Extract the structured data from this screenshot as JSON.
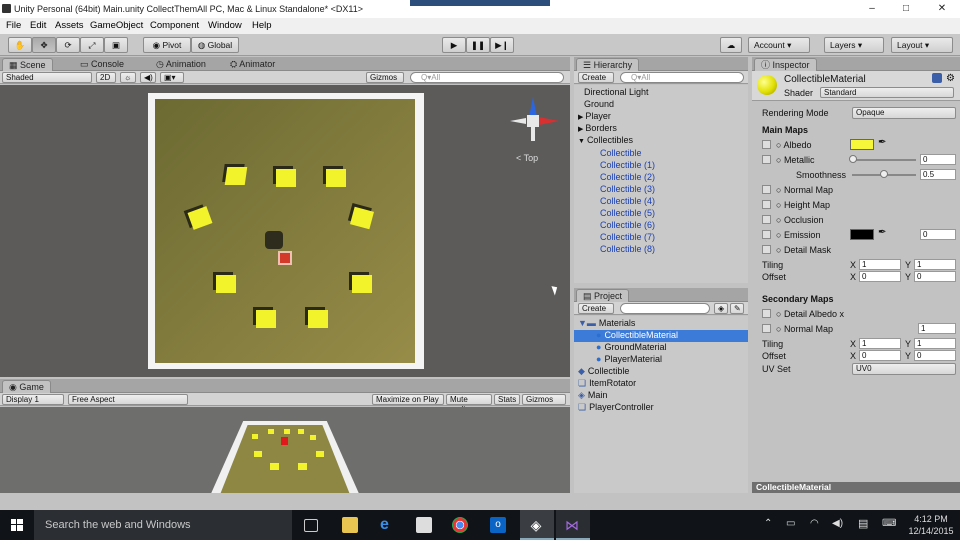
{
  "window": {
    "title": "Unity Personal (64bit)   Main.unity   CollectThemAll   PC, Mac & Linux Standalone* <DX11>",
    "minimize": "–",
    "maximize": "□",
    "close": "✕"
  },
  "menu": [
    "File",
    "Edit",
    "Assets",
    "GameObject",
    "Component",
    "Window",
    "Help"
  ],
  "toolbar": {
    "pivot": "Pivot",
    "global": "Global",
    "account": "Account",
    "layers": "Layers",
    "layout": "Layout"
  },
  "scene": {
    "tabs": {
      "scene": "Scene",
      "console": "Console",
      "animation": "Animation",
      "animator": "Animator"
    },
    "shading": "Shaded",
    "mode2d": "2D",
    "gizmos": "Gizmos",
    "search_placeholder": "Q▾All",
    "view_label": "< Top"
  },
  "game": {
    "tab": "Game",
    "display": "Display 1",
    "aspect": "Free Aspect",
    "maximize": "Maximize on Play",
    "mute": "Mute audio",
    "stats": "Stats",
    "gizmos": "Gizmos"
  },
  "hierarchy": {
    "tab": "Hierarchy",
    "create": "Create",
    "search_placeholder": "Q▾All",
    "items": [
      {
        "label": "Directional Light",
        "indent": 0,
        "arrow": "",
        "blue": false
      },
      {
        "label": "Ground",
        "indent": 0,
        "arrow": "",
        "blue": false
      },
      {
        "label": "Player",
        "indent": 0,
        "arrow": "▶",
        "blue": false
      },
      {
        "label": "Borders",
        "indent": 0,
        "arrow": "▶",
        "blue": false
      },
      {
        "label": "Collectibles",
        "indent": 0,
        "arrow": "▼",
        "blue": false
      },
      {
        "label": "Collectible",
        "indent": 1,
        "arrow": "",
        "blue": true
      },
      {
        "label": "Collectible (1)",
        "indent": 1,
        "arrow": "",
        "blue": true
      },
      {
        "label": "Collectible (2)",
        "indent": 1,
        "arrow": "",
        "blue": true
      },
      {
        "label": "Collectible (3)",
        "indent": 1,
        "arrow": "",
        "blue": true
      },
      {
        "label": "Collectible (4)",
        "indent": 1,
        "arrow": "",
        "blue": true
      },
      {
        "label": "Collectible (5)",
        "indent": 1,
        "arrow": "",
        "blue": true
      },
      {
        "label": "Collectible (6)",
        "indent": 1,
        "arrow": "",
        "blue": true
      },
      {
        "label": "Collectible (7)",
        "indent": 1,
        "arrow": "",
        "blue": true
      },
      {
        "label": "Collectible (8)",
        "indent": 1,
        "arrow": "",
        "blue": true
      }
    ]
  },
  "project": {
    "tab": "Project",
    "create": "Create",
    "items": [
      {
        "label": "Materials",
        "indent": 0,
        "icon": "folder-icon",
        "selected": false
      },
      {
        "label": "CollectibleMaterial",
        "indent": 1,
        "icon": "material-icon",
        "selected": true
      },
      {
        "label": "GroundMaterial",
        "indent": 1,
        "icon": "material-icon",
        "selected": false
      },
      {
        "label": "PlayerMaterial",
        "indent": 1,
        "icon": "material-icon",
        "selected": false
      },
      {
        "label": "Collectible",
        "indent": 0,
        "icon": "prefab-icon",
        "selected": false
      },
      {
        "label": "ItemRotator",
        "indent": 0,
        "icon": "script-icon",
        "selected": false
      },
      {
        "label": "Main",
        "indent": 0,
        "icon": "unity-scene-icon",
        "selected": false
      },
      {
        "label": "PlayerController",
        "indent": 0,
        "icon": "script-icon",
        "selected": false
      }
    ]
  },
  "inspector": {
    "tab": "Inspector",
    "material_name": "CollectibleMaterial",
    "shader_label": "Shader",
    "shader_value": "Standard",
    "rendering_mode_label": "Rendering Mode",
    "rendering_mode": "Opaque",
    "main_maps": "Main Maps",
    "albedo": "Albedo",
    "albedo_color": "#f6f63a",
    "metallic": "Metallic",
    "metallic_value": "0",
    "smoothness": "Smoothness",
    "smoothness_value": "0.5",
    "normal_map": "Normal Map",
    "height_map": "Height Map",
    "occlusion": "Occlusion",
    "emission": "Emission",
    "emission_value": "0",
    "emission_color": "#000000",
    "detail_mask": "Detail Mask",
    "tiling": "Tiling",
    "offset": "Offset",
    "tiling_x": "1",
    "tiling_y": "1",
    "offset_x": "0",
    "offset_y": "0",
    "secondary_maps": "Secondary Maps",
    "detail_albedo": "Detail Albedo x",
    "normal_map2": "Normal Map",
    "normal_map2_value": "1",
    "tiling2": "Tiling",
    "offset2": "Offset",
    "tiling2_x": "1",
    "tiling2_y": "1",
    "offset2_x": "0",
    "offset2_y": "0",
    "uv_set": "UV Set",
    "uv_set_value": "UV0",
    "x": "X",
    "y": "Y",
    "footer": "CollectibleMaterial"
  },
  "taskbar": {
    "search": "Search the web and Windows",
    "time": "4:12 PM",
    "date": "12/14/2015"
  }
}
